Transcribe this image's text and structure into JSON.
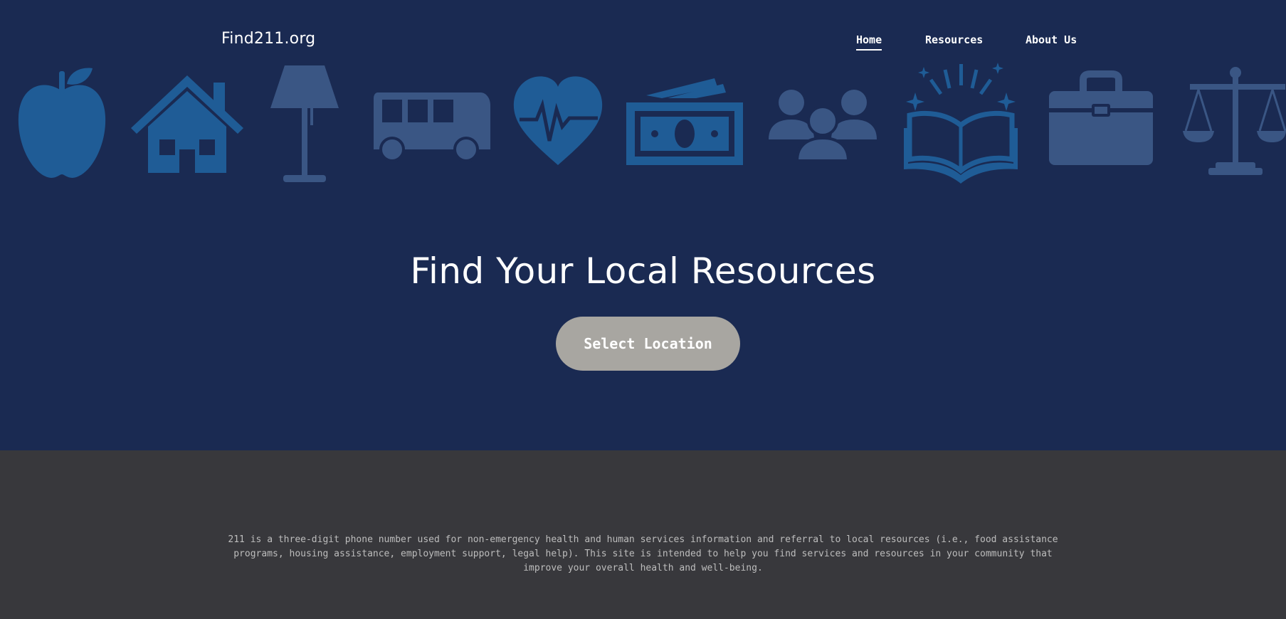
{
  "header": {
    "logo": "Find211.org",
    "nav": [
      {
        "label": "Home",
        "active": true
      },
      {
        "label": "Resources",
        "active": false
      },
      {
        "label": "About Us",
        "active": false
      }
    ]
  },
  "hero": {
    "icons": [
      "apple-icon",
      "house-icon",
      "lamp-icon",
      "bus-icon",
      "heart-pulse-icon",
      "money-icon",
      "people-group-icon",
      "open-book-icon",
      "briefcase-icon",
      "scales-icon"
    ],
    "icon_colors": {
      "blue": "#1f5c96",
      "slate": "#3a5684"
    },
    "headline": "Find Your Local Resources",
    "cta_label": "Select Location"
  },
  "about": {
    "text": "211 is a three-digit phone number used for non-emergency health and human services information and referral to local resources (i.e., food assistance programs, housing assistance, employment support, legal help). This site is intended to help you find services and resources in your community that improve your overall health and well-being."
  },
  "colors": {
    "hero_bg": "#1a2a52",
    "about_bg": "#38383c",
    "button_bg": "#a8a6a1",
    "text_white": "#ffffff"
  }
}
